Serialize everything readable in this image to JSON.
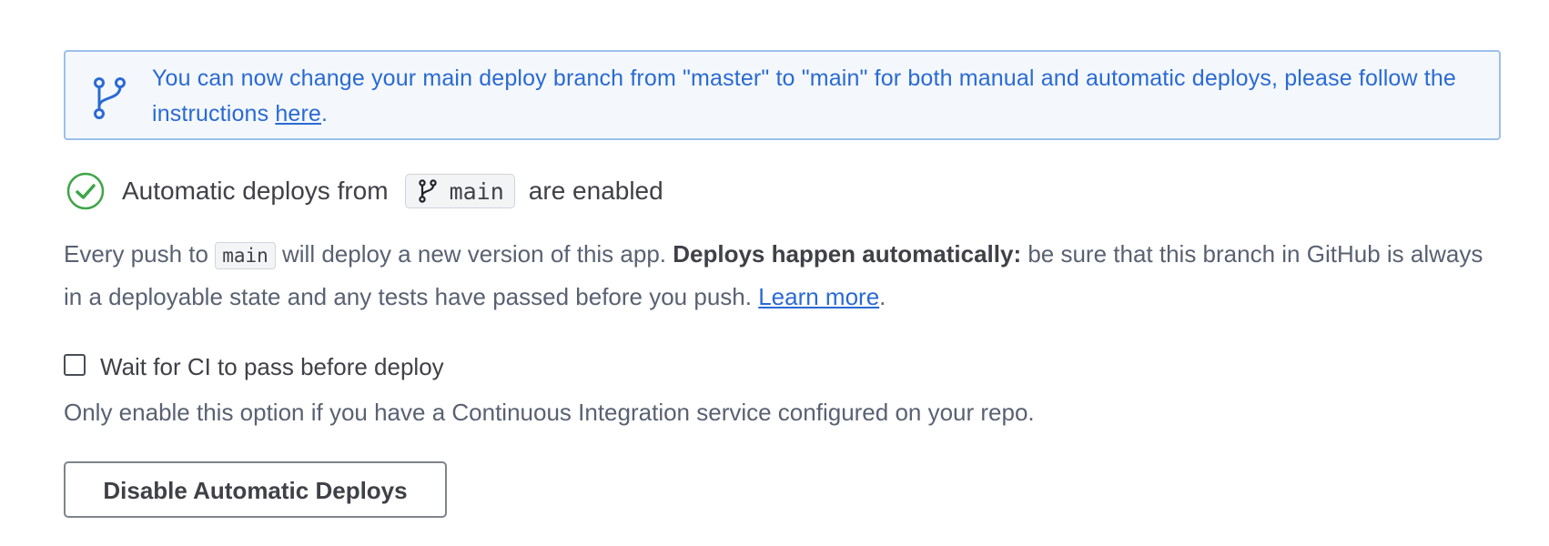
{
  "banner": {
    "icon": "git-branch-icon",
    "text_before": "You can now change your main deploy branch from \"master\" to \"main\" for both manual and automatic deploys, please follow the instructions ",
    "link_text": "here",
    "text_after": ".",
    "color": "#2a6ad4"
  },
  "status": {
    "icon": "check-circle-icon",
    "lead": "Automatic deploys from",
    "branch": "main",
    "tail": "are enabled"
  },
  "description": {
    "part1": "Every push to ",
    "branch": "main",
    "part2": " will deploy a new version of this app. ",
    "bold": "Deploys happen automatically:",
    "part3": " be sure that this branch in GitHub is always in a deployable state and any tests have passed before you push. ",
    "link_text": "Learn more",
    "part4": "."
  },
  "ci": {
    "checkbox_label": "Wait for CI to pass before deploy",
    "checked": false,
    "help_text": "Only enable this option if you have a Continuous Integration service configured on your repo."
  },
  "button": {
    "label": "Disable Automatic Deploys"
  },
  "colors": {
    "success": "#3ea548",
    "link": "#2a6ad4",
    "banner_border": "#9cc0ea",
    "banner_bg": "#f4f8fd"
  }
}
